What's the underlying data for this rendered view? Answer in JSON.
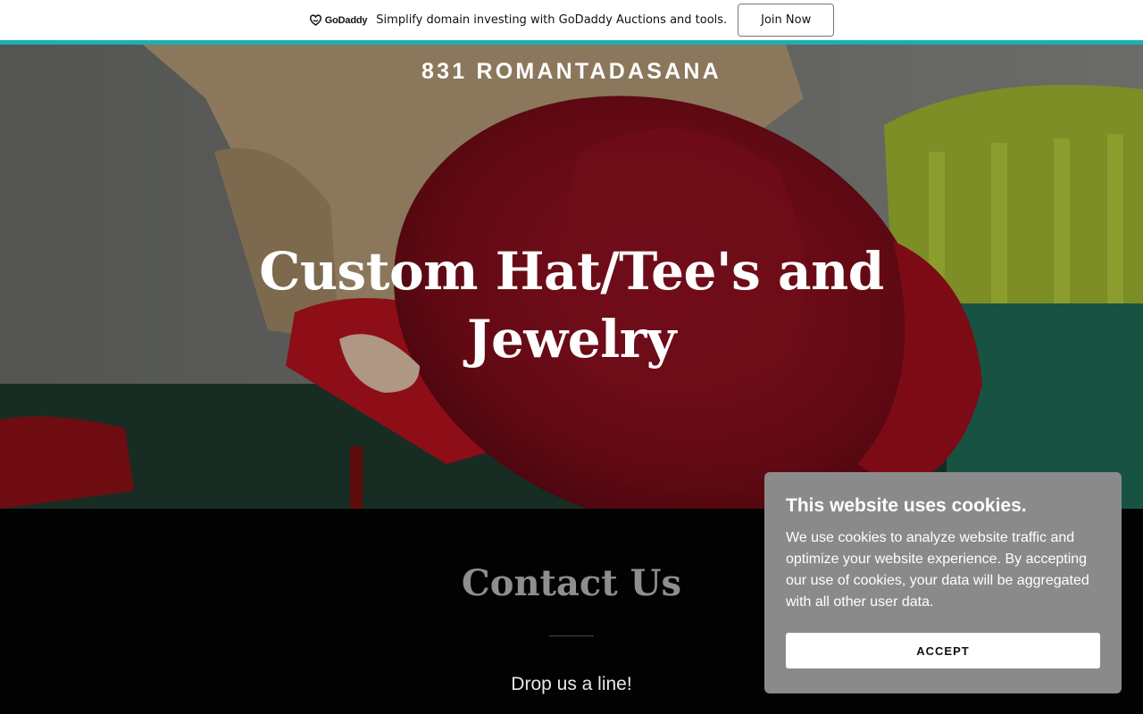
{
  "promo": {
    "logo_text": "GoDaddy",
    "message": "Simplify domain investing with GoDaddy Auctions and tools.",
    "join_label": "Join Now",
    "accent_color": "#1bb0b3"
  },
  "header": {
    "site_name": "831 ROMANTADASANA"
  },
  "hero": {
    "title": "Custom Hat/Tee's and Jewelry"
  },
  "contact": {
    "title": "Contact Us",
    "subtitle": "Drop us a line!"
  },
  "cookie_banner": {
    "title": "This website uses cookies.",
    "body": "We use cookies to analyze website traffic and optimize your website experience. By accepting our use of cookies, your data will be aggregated with all other user data.",
    "accept_label": "ACCEPT"
  }
}
